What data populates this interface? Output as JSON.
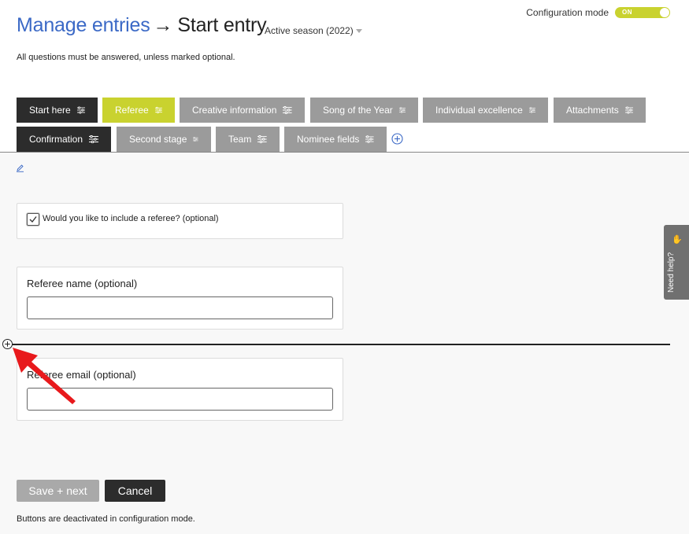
{
  "header": {
    "title_link": "Manage entries",
    "title_arrow": "→",
    "title_page": "Start entry",
    "season": "Active season (2022)",
    "subtitle": "All questions must be answered, unless marked optional."
  },
  "config": {
    "label": "Configuration mode",
    "toggle_state": "ON",
    "accent": "#c9d22f"
  },
  "tabs": [
    {
      "label": "Start here",
      "style": "dark"
    },
    {
      "label": "Referee",
      "style": "active"
    },
    {
      "label": "Creative information",
      "style": "grey"
    },
    {
      "label": "Song of the Year",
      "style": "grey"
    },
    {
      "label": "Individual excellence",
      "style": "grey"
    },
    {
      "label": "Attachments",
      "style": "grey"
    },
    {
      "label": "Confirmation",
      "style": "dark"
    },
    {
      "label": "Second stage",
      "style": "grey"
    },
    {
      "label": "Team",
      "style": "grey"
    },
    {
      "label": "Nominee fields",
      "style": "grey"
    }
  ],
  "form": {
    "checkbox_label": "Would you like to include a referee? (optional)",
    "checkbox_checked": true,
    "referee_name_label": "Referee name (optional)",
    "referee_name_value": "",
    "referee_email_label": "Referee email (optional)",
    "referee_email_value": ""
  },
  "actions": {
    "save_label": "Save + next",
    "cancel_label": "Cancel",
    "footnote": "Buttons are deactivated in configuration mode."
  },
  "help": {
    "label": "Need help?"
  },
  "colors": {
    "link": "#3b69c6",
    "tab_dark": "#2c2c2c",
    "tab_grey": "#9b9b9b",
    "annotation_arrow": "#e8191c"
  }
}
